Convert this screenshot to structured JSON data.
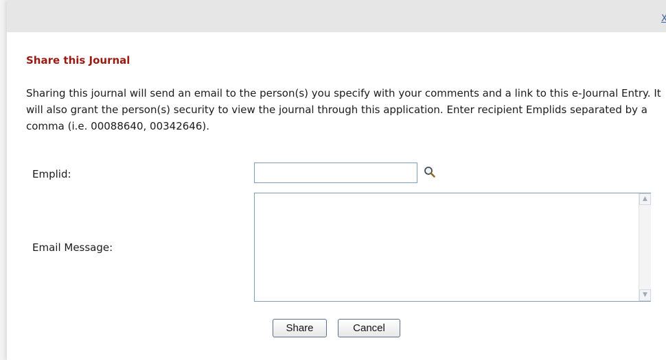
{
  "dialog": {
    "close_label": "X",
    "heading": "Share this Journal",
    "description": "Sharing this journal will send an email to the person(s) you specify with your comments and a link to this e-Journal Entry. It will also grant the person(s) security to view the journal through this application. Enter recipient Emplids separated by a comma (i.e. 00088640, 00342646)."
  },
  "form": {
    "emplid_label": "Emplid:",
    "emplid_value": "",
    "message_label": "Email Message:",
    "message_value": ""
  },
  "buttons": {
    "share_label": "Share",
    "cancel_label": "Cancel"
  },
  "icons": {
    "lookup": "search-icon",
    "scroll_up": "arrow-up-icon",
    "scroll_down": "arrow-down-icon"
  }
}
